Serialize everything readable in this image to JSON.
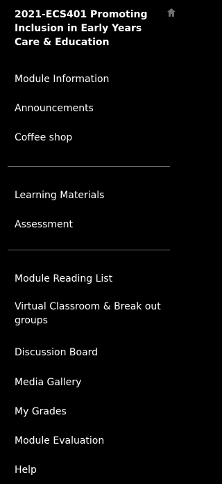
{
  "course": {
    "title": "2021-ECS401 Promoting Inclusion in Early Years Care & Education"
  },
  "icons": {
    "home": "home-icon"
  },
  "colors": {
    "background": "#000000",
    "text": "#ffffff",
    "divider": "#6c6c6c",
    "icon": "#6f6f6f"
  },
  "menu": {
    "group1": [
      "Module Information",
      "Announcements",
      "Coffee shop"
    ],
    "group2": [
      "Learning Materials",
      "Assessment"
    ],
    "group3": [
      "Module Reading List",
      "Virtual Classroom & Break out groups",
      "Discussion Board",
      "Media Gallery",
      "My Grades",
      "Module Evaluation",
      "Help"
    ]
  }
}
